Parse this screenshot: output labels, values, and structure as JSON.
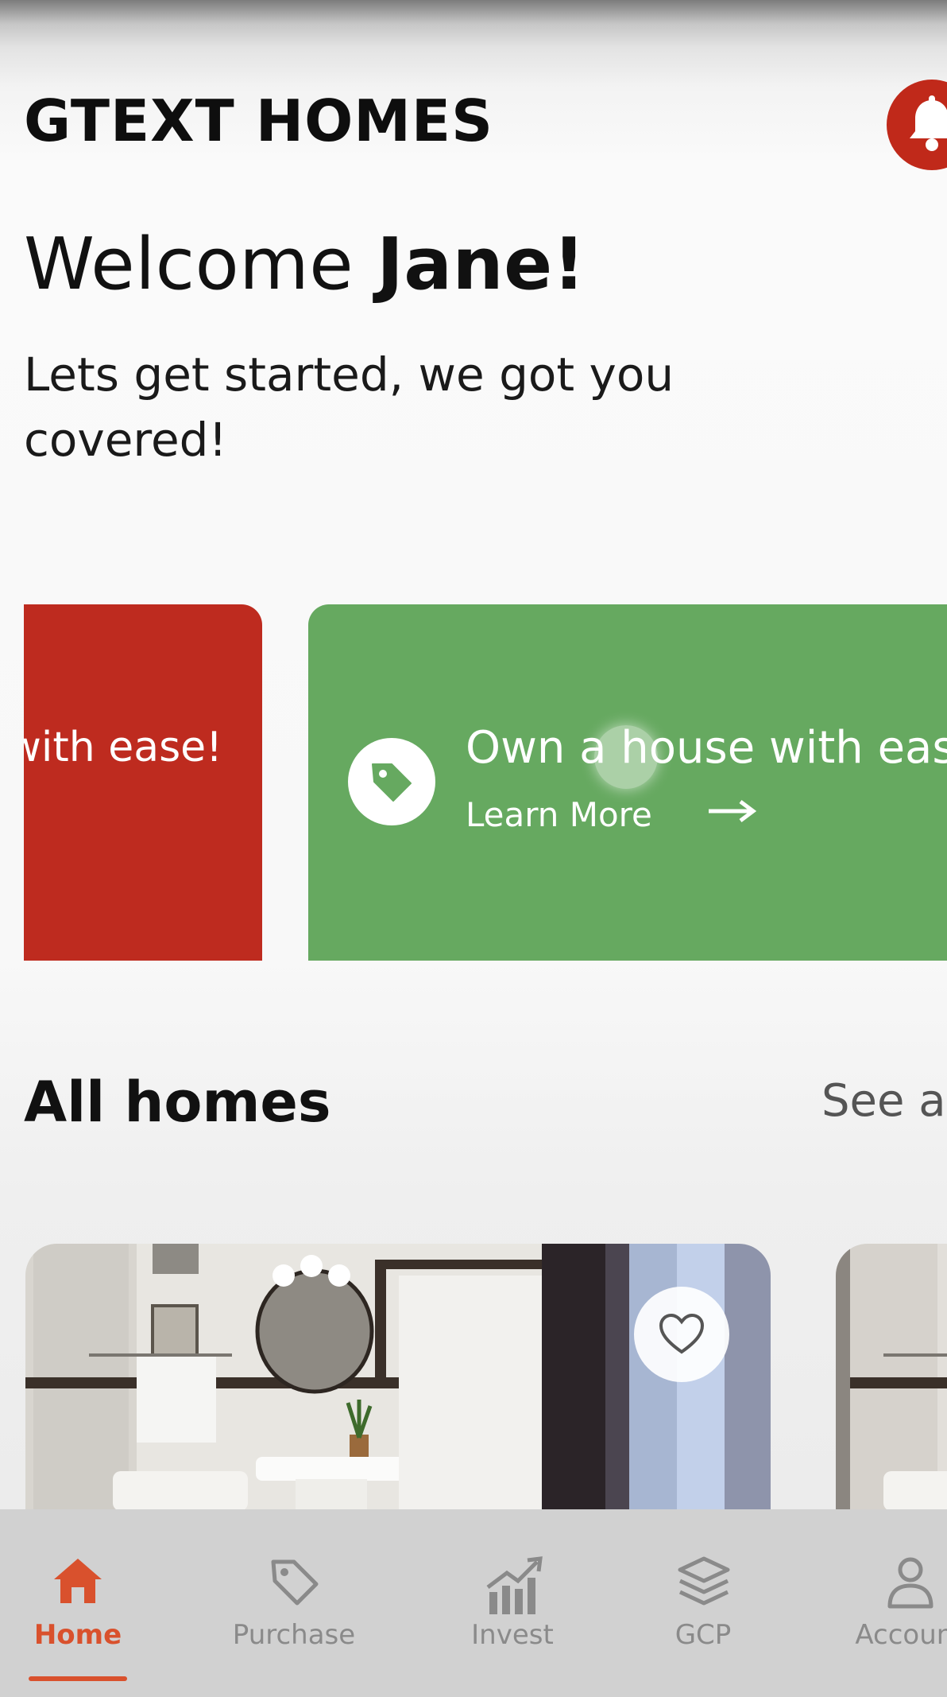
{
  "header": {
    "brand": "GTEXT HOMES",
    "welcome_prefix": "Welcome ",
    "user_name": "Jane!",
    "subtitle": "Lets get started, we got you covered!"
  },
  "carousel": {
    "cards": [
      {
        "title": "with ease!",
        "color": "#be2b1f"
      },
      {
        "title": "Own a house with ease!",
        "link": "Learn More",
        "color": "#66a960",
        "icon": "tag-icon"
      }
    ]
  },
  "section": {
    "title": "All homes",
    "see_all": "See all"
  },
  "nav": {
    "items": [
      {
        "label": "Home",
        "icon": "home-icon",
        "active": true
      },
      {
        "label": "Purchase",
        "icon": "tag-icon"
      },
      {
        "label": "Invest",
        "icon": "chart-icon"
      },
      {
        "label": "GCP",
        "icon": "layers-icon"
      },
      {
        "label": "Account",
        "icon": "user-icon"
      }
    ]
  },
  "colors": {
    "accent": "#d9512d",
    "brand_red": "#c0291a",
    "card_green": "#66a960"
  }
}
